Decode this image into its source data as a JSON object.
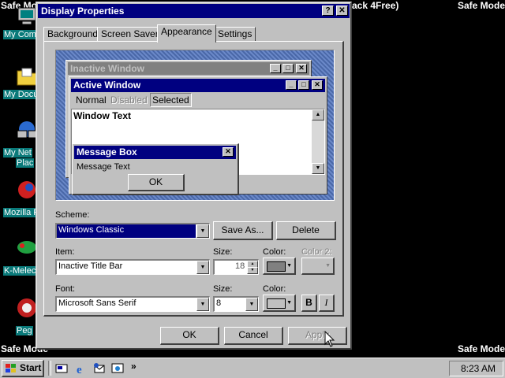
{
  "desktop": {
    "safe_mode": "Safe Mode",
    "background_text": "ack 4Free)",
    "icons": [
      {
        "label": "My Com",
        "icon": "my-computer-icon"
      },
      {
        "label": "My Docu",
        "icon": "my-documents-icon"
      },
      {
        "label": "My Net",
        "icon": "network-icon"
      },
      {
        "label": "Plac",
        "icon": "network-icon"
      },
      {
        "label": "Mozilla F",
        "icon": "mozilla-icon"
      },
      {
        "label": "K-Melec",
        "icon": "k-meleon-icon"
      },
      {
        "label": "Peg",
        "icon": "pegasus-icon"
      }
    ]
  },
  "dialog": {
    "title": "Display Properties",
    "help_btn": "?",
    "close_btn": "✕",
    "tabs": [
      "Background",
      "Screen Saver",
      "Appearance",
      "Settings"
    ],
    "active_tab": "Appearance",
    "preview": {
      "inactive_title": "Inactive Window",
      "active_title": "Active Window",
      "menu": [
        "Normal",
        "Disabled",
        "Selected"
      ],
      "window_text": "Window Text",
      "msgbox_title": "Message Box",
      "msgbox_text": "Message Text",
      "msgbox_ok": "OK"
    },
    "scheme_label": "Scheme:",
    "scheme_value": "Windows Classic",
    "save_as": "Save As...",
    "delete": "Delete",
    "item_label": "Item:",
    "item_value": "Inactive Title Bar",
    "size_label": "Size:",
    "item_size": "18",
    "color_label": "Color:",
    "color2_label": "Color 2:",
    "font_label": "Font:",
    "font_value": "Microsoft Sans Serif",
    "font_size_label": "Size:",
    "font_size": "8",
    "font_color_label": "Color:",
    "bold": "B",
    "italic": "I",
    "ok": "OK",
    "cancel": "Cancel",
    "apply": "Apply",
    "colors": {
      "title_active": "#000080",
      "inactive_title": "#808080",
      "item_color": "#808080"
    }
  },
  "taskbar": {
    "start": "Start",
    "time": "8:23 AM",
    "more": "»",
    "quick_launch": [
      "show-desktop-icon",
      "ie-icon",
      "outlook-icon",
      "channels-icon"
    ]
  }
}
